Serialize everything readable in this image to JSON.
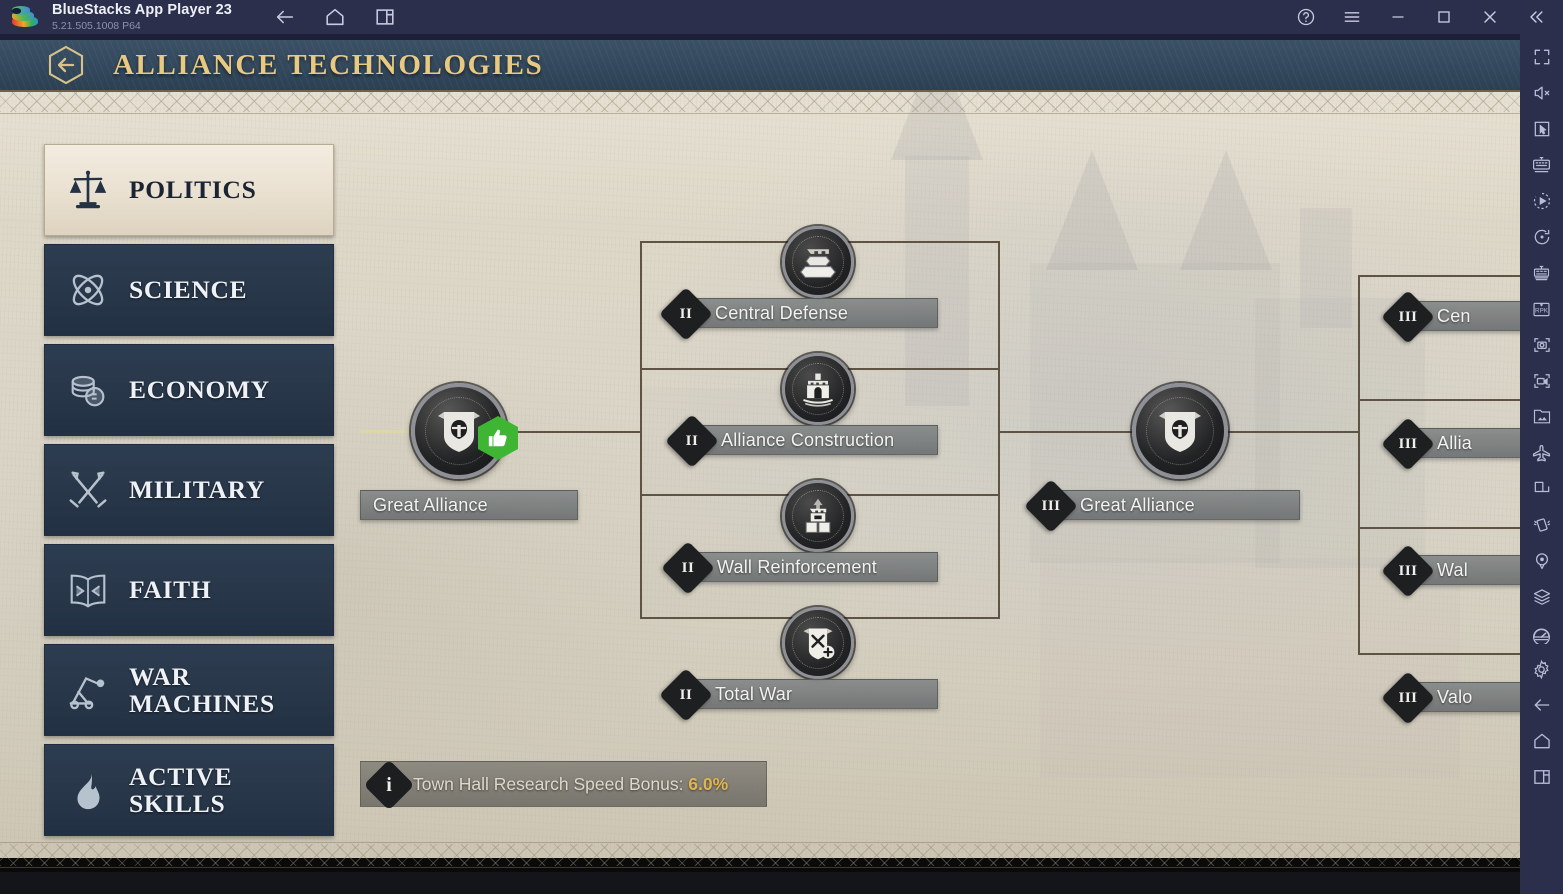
{
  "titlebar": {
    "app_name": "BlueStacks App Player 23",
    "version": "5.21.505.1008  P64",
    "logo_icon": "bluestacks-logo",
    "nav": [
      {
        "name": "back-icon",
        "label": "Back"
      },
      {
        "name": "home-icon",
        "label": "Home"
      },
      {
        "name": "recents-icon",
        "label": "Recent apps"
      }
    ],
    "controls": [
      {
        "name": "help-icon",
        "label": "Help"
      },
      {
        "name": "hamburger-menu-icon",
        "label": "Menu"
      },
      {
        "name": "minimize-icon",
        "label": "Minimize"
      },
      {
        "name": "maximize-icon",
        "label": "Maximize"
      },
      {
        "name": "close-icon",
        "label": "Close"
      },
      {
        "name": "collapse-sidebar-icon",
        "label": "Collapse"
      }
    ]
  },
  "sidebar_rail": {
    "items": [
      {
        "name": "fullscreen-icon",
        "label": "Fullscreen"
      },
      {
        "name": "mute-icon",
        "label": "Mute"
      },
      {
        "name": "cursor-icon",
        "label": "Pointer"
      },
      {
        "name": "keyboard-controls-icon",
        "label": "Game controls"
      },
      {
        "name": "macro-play-icon",
        "label": "Macros"
      },
      {
        "name": "rotate-icon",
        "label": "Rotate"
      },
      {
        "name": "multi-instance-icon",
        "label": "Multi-instance"
      },
      {
        "name": "rpk-icon",
        "label": "Install APK"
      },
      {
        "name": "screenshot-icon",
        "label": "Screenshot"
      },
      {
        "name": "record-video-icon",
        "label": "Record"
      },
      {
        "name": "media-gallery-icon",
        "label": "Media manager"
      },
      {
        "name": "eco-mode-icon",
        "label": "Eco mode"
      },
      {
        "name": "resize-icon",
        "label": "Resize"
      },
      {
        "name": "shake-icon",
        "label": "Shake"
      },
      {
        "name": "location-icon",
        "label": "Location"
      },
      {
        "name": "layers-icon",
        "label": "Layers"
      },
      {
        "name": "performance-icon",
        "label": "Performance"
      },
      {
        "name": "settings-gear-icon",
        "label": "Settings"
      },
      {
        "name": "back-icon",
        "label": "Back"
      },
      {
        "name": "home-icon",
        "label": "Home"
      },
      {
        "name": "recents-icon",
        "label": "Recents"
      }
    ]
  },
  "game_header": {
    "title": "ALLIANCE TECHNOLOGIES",
    "back_button_icon": "hexagon-back-arrow-icon"
  },
  "categories": [
    {
      "label": "POLITICS",
      "icon": "scales-icon",
      "selected": true
    },
    {
      "label": "SCIENCE",
      "icon": "atom-icon",
      "selected": false
    },
    {
      "label": "ECONOMY",
      "icon": "coins-icon",
      "selected": false
    },
    {
      "label": "MILITARY",
      "icon": "swords-icon",
      "selected": false
    },
    {
      "label": "FAITH",
      "icon": "book-icon",
      "selected": false
    },
    {
      "label": "WAR MACHINES",
      "icon": "catapult-icon",
      "selected": false
    },
    {
      "label": "ACTIVE SKILLS",
      "icon": "flame-icon",
      "selected": false
    }
  ],
  "tech_tree": {
    "tier1": [
      {
        "name": "Great Alliance",
        "rank": "",
        "icon": "alliance-crest-icon",
        "status_badge": "thumbs-up-icon",
        "badge_color": "#3fb534"
      }
    ],
    "tier2": [
      {
        "name": "Central Defense",
        "rank": "II",
        "icon": "fortification-icon"
      },
      {
        "name": "Alliance Construction",
        "rank": "II",
        "icon": "castle-gate-icon"
      },
      {
        "name": "Wall Reinforcement",
        "rank": "II",
        "icon": "wall-tower-icon"
      },
      {
        "name": "Total War",
        "rank": "II",
        "icon": "banner-swords-icon"
      }
    ],
    "tier3_hub": [
      {
        "name": "Great Alliance",
        "rank": "III",
        "icon": "alliance-crest-icon"
      }
    ],
    "tier4_partial": [
      {
        "name": "Cen",
        "rank": "III"
      },
      {
        "name": "Allia",
        "rank": "III"
      },
      {
        "name": "Wal",
        "rank": "III"
      },
      {
        "name": "Valo",
        "rank": "III"
      }
    ]
  },
  "info_bar": {
    "icon": "info-icon",
    "text": "Town Hall Research Speed Bonus: ",
    "value": "6.0%"
  },
  "colors": {
    "header_gold": "#e8c981",
    "panel_navy": "#2d3d51",
    "parchment": "#ded8c9",
    "accent_green": "#3fb534",
    "accent_amber": "#e0b44e"
  }
}
